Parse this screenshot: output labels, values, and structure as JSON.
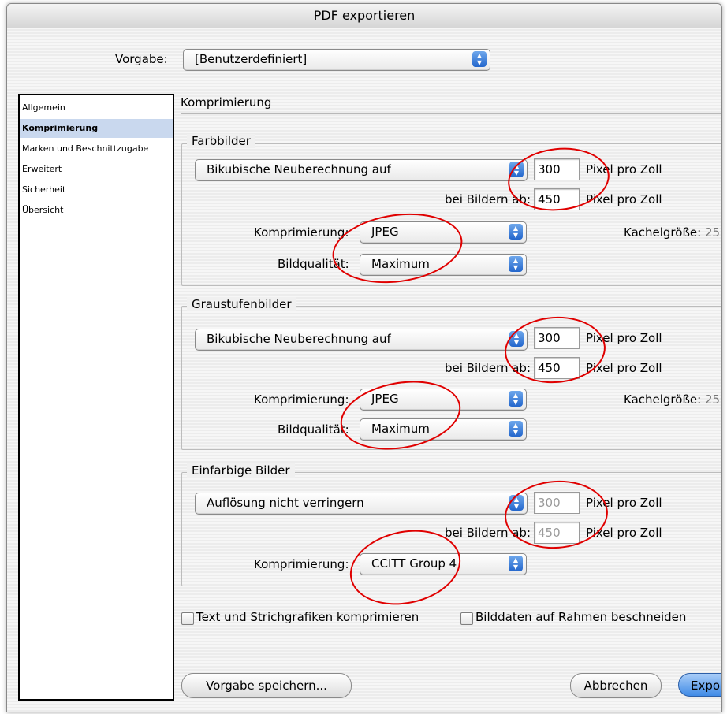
{
  "window": {
    "title": "PDF exportieren"
  },
  "preset": {
    "label": "Vorgabe:",
    "value": "[Benutzerdefiniert]"
  },
  "sidebar": {
    "items": [
      {
        "label": "Allgemein",
        "selected": false
      },
      {
        "label": "Komprimierung",
        "selected": true
      },
      {
        "label": "Marken und Beschnittzugabe",
        "selected": false
      },
      {
        "label": "Erweitert",
        "selected": false
      },
      {
        "label": "Sicherheit",
        "selected": false
      },
      {
        "label": "Übersicht",
        "selected": false
      }
    ]
  },
  "section_title": "Komprimierung",
  "color_images": {
    "title": "Farbbilder",
    "resampling": "Bikubische Neuberechnung auf",
    "resolution": "300",
    "resolution_unit": "Pixel pro Zoll",
    "above_label": "bei Bildern ab:",
    "above_value": "450",
    "above_unit": "Pixel pro Zoll",
    "compression_label": "Komprimierung:",
    "compression": "JPEG",
    "tile_label": "Kachelgröße:",
    "tile_value": "25",
    "quality_label": "Bildqualität:",
    "quality": "Maximum"
  },
  "gray_images": {
    "title": "Graustufenbilder",
    "resampling": "Bikubische Neuberechnung auf",
    "resolution": "300",
    "resolution_unit": "Pixel pro Zoll",
    "above_label": "bei Bildern ab:",
    "above_value": "450",
    "above_unit": "Pixel pro Zoll",
    "compression_label": "Komprimierung:",
    "compression": "JPEG",
    "tile_label": "Kachelgröße:",
    "tile_value": "25",
    "quality_label": "Bildqualität:",
    "quality": "Maximum"
  },
  "mono_images": {
    "title": "Einfarbige Bilder",
    "resampling": "Auflösung nicht verringern",
    "resolution": "300",
    "resolution_unit": "Pixel pro Zoll",
    "above_label": "bei Bildern ab:",
    "above_value": "450",
    "above_unit": "Pixel pro Zoll",
    "compression_label": "Komprimierung:",
    "compression": "CCITT Group 4"
  },
  "options": {
    "compress_text": "Text und Strichgrafiken komprimieren",
    "crop_images": "Bilddaten auf Rahmen beschneiden"
  },
  "buttons": {
    "save_preset": "Vorgabe speichern...",
    "cancel": "Abbrechen",
    "export": "Exportieren"
  },
  "colors": {
    "annotation": "#e00000",
    "accent": "#2366cc",
    "selection": "#c9d8ee"
  }
}
